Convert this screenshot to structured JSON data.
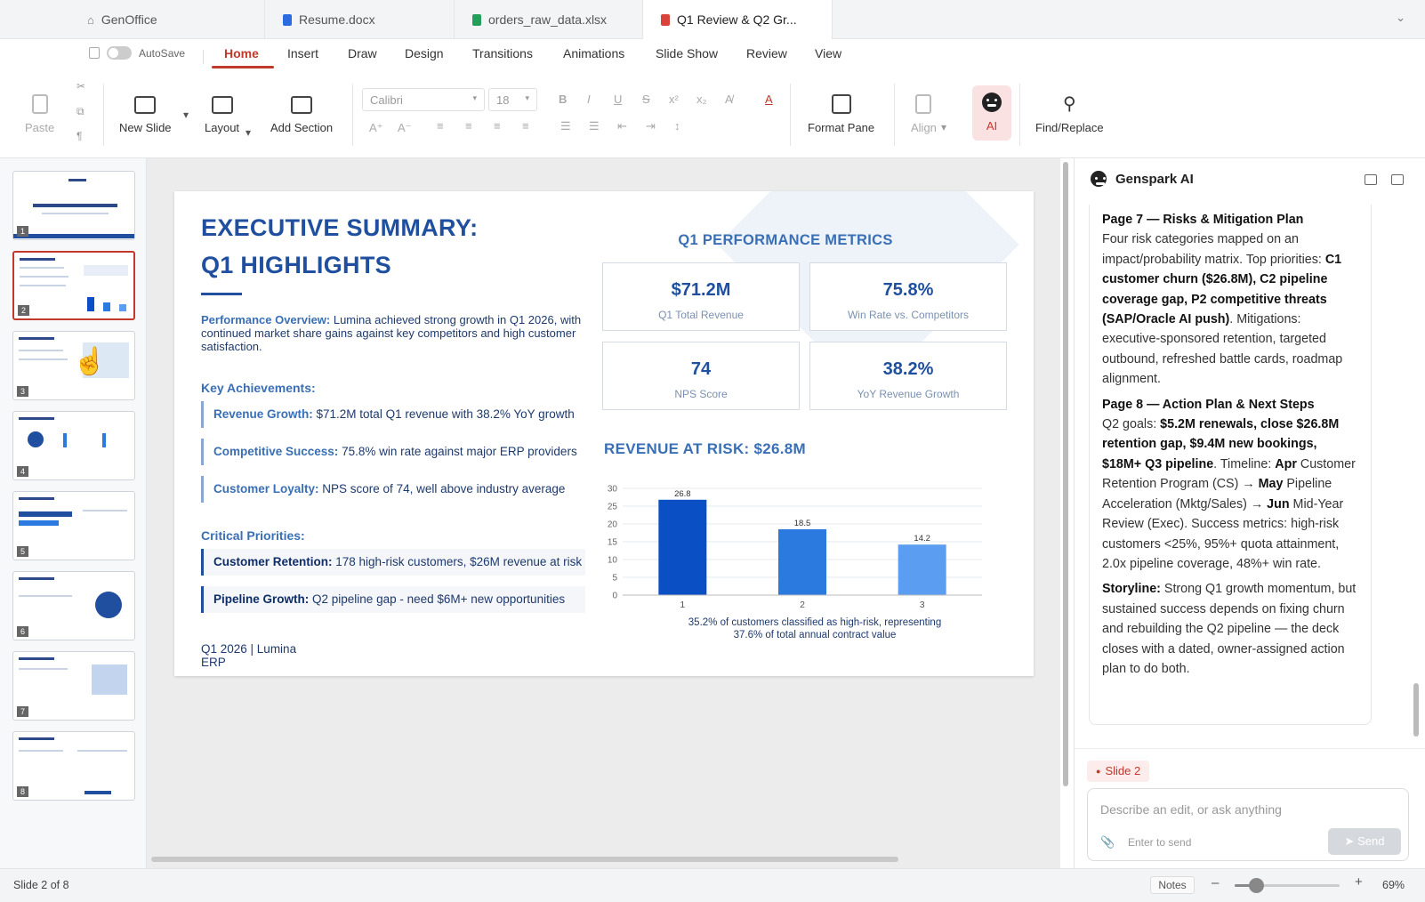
{
  "tabs": [
    {
      "label": "GenOffice",
      "icon": "home-icon"
    },
    {
      "label": "Resume.docx",
      "icon": "word-doc-icon"
    },
    {
      "label": "orders_raw_data.xlsx",
      "icon": "spreadsheet-icon"
    },
    {
      "label": "Q1 Review & Q2 Gr...",
      "icon": "presentation-icon"
    }
  ],
  "menu": {
    "autosave": "AutoSave",
    "items": [
      "Home",
      "Insert",
      "Draw",
      "Design",
      "Transitions",
      "Animations",
      "Slide Show",
      "Review",
      "View"
    ],
    "active": "Home"
  },
  "ribbon": {
    "paste": "Paste",
    "new_slide": "New Slide",
    "layout": "Layout",
    "add_section": "Add Section",
    "font_name": "Calibri",
    "font_size": "18",
    "format_pane": "Format Pane",
    "align": "Align",
    "ai": "AI",
    "find_replace": "Find/Replace"
  },
  "thumbnails": [
    "1",
    "2",
    "3",
    "4",
    "5",
    "6",
    "7",
    "8"
  ],
  "selected_slide": "2",
  "slide": {
    "title_line1": "EXECUTIVE SUMMARY:",
    "title_line2": "Q1 HIGHLIGHTS",
    "overview_label": "Performance Overview:",
    "overview_text": " Lumina achieved strong growth in Q1 2026, with continued market share gains against key competitors and high customer satisfaction.",
    "achievements_heading": "Key Achievements:",
    "achievements": [
      {
        "label": "Revenue Growth:",
        "text": " $71.2M total Q1 revenue with 38.2% YoY growth"
      },
      {
        "label": "Competitive Success:",
        "text": " 75.8% win rate against major ERP providers"
      },
      {
        "label": "Customer Loyalty:",
        "text": " NPS score of 74, well above industry average"
      }
    ],
    "priorities_heading": "Critical Priorities:",
    "priorities": [
      {
        "label": "Customer Retention:",
        "text": " 178 high-risk customers, $26M revenue at risk"
      },
      {
        "label": "Pipeline Growth:",
        "text": " Q2 pipeline gap - need $6M+ new opportunities"
      }
    ],
    "footer_line1": "Q1 2026 | Lumina",
    "footer_line2": "ERP",
    "metrics_title": "Q1 PERFORMANCE METRICS",
    "metrics": [
      {
        "value": "$71.2M",
        "label": "Q1 Total Revenue"
      },
      {
        "value": "75.8%",
        "label": "Win Rate vs. Competitors"
      },
      {
        "value": "74",
        "label": "NPS Score"
      },
      {
        "value": "38.2%",
        "label": "YoY Revenue Growth"
      }
    ],
    "risk_title": "REVENUE AT RISK: $26.8M",
    "caption_line1": "35.2% of customers classified as high-risk, representing",
    "caption_line2": "37.6% of total annual contract value"
  },
  "chart_data": {
    "type": "bar",
    "categories": [
      "1",
      "2",
      "3"
    ],
    "values": [
      26.8,
      18.5,
      14.2
    ],
    "data_labels": [
      "26.8",
      "18.5",
      "14.2"
    ],
    "ylim": [
      0,
      30
    ],
    "yticks": [
      0,
      5,
      10,
      15,
      20,
      25,
      30
    ],
    "bar_colors": [
      "#0b4fc4",
      "#2b7ae0",
      "#5b9df0"
    ],
    "grid": true,
    "title": "",
    "xlabel": "",
    "ylabel": ""
  },
  "assistant": {
    "title": "Genspark AI",
    "p1_heading": "Page 7 — Risks & Mitigation Plan",
    "p1_a": "Four risk categories mapped on an impact/probability matrix. Top priorities: ",
    "p1_b": "C1 customer churn ($26.8M), C2 pipeline coverage gap, P2 competitive threats (SAP/Oracle AI push)",
    "p1_c": ". Mitigations: executive-sponsored retention, targeted outbound, refreshed battle cards, roadmap alignment.",
    "p2_heading": "Page 8 — Action Plan & Next Steps",
    "p2_a": "Q2 goals: ",
    "p2_b": "$5.2M renewals, close $26.8M retention gap, $9.4M new bookings, $18M+ Q3 pipeline",
    "p2_c": ". Timeline: ",
    "p2_d": "Apr",
    "p2_e": " Customer Retention Program (CS) → ",
    "p2_f": "May",
    "p2_g": " Pipeline Acceleration (Mktg/Sales) → ",
    "p2_h": "Jun",
    "p2_i": " Mid-Year Review (Exec). Success metrics: high-risk customers <25%, 95%+ quota attainment, 2.0x pipeline coverage, 48%+ win rate.",
    "p3_label": "Storyline:",
    "p3_text": " Strong Q1 growth momentum, but sustained success depends on fixing churn and rebuilding the Q2 pipeline — the deck closes with a dated, owner-assigned action plan to do both.",
    "chip": "Slide 2",
    "input_placeholder": "Describe an edit, or ask anything",
    "enter_hint": "Enter to send",
    "send": "Send"
  },
  "status": {
    "slide_info": "Slide 2 of 8",
    "notes": "Notes",
    "zoom": "69%",
    "zoom_level": 0.24
  }
}
